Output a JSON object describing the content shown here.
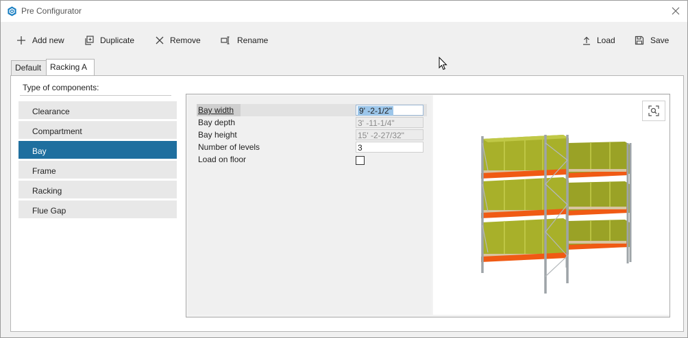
{
  "window": {
    "title": "Pre Configurator"
  },
  "toolbar": {
    "add_new": "Add new",
    "duplicate": "Duplicate",
    "remove": "Remove",
    "rename": "Rename",
    "load": "Load",
    "save": "Save"
  },
  "tabs": [
    {
      "label": "Default",
      "active": false
    },
    {
      "label": "Racking A",
      "active": true
    }
  ],
  "components": {
    "heading": "Type of components:",
    "items": [
      "Clearance",
      "Compartment",
      "Bay",
      "Frame",
      "Racking",
      "Flue Gap"
    ],
    "selected": "Bay"
  },
  "properties": [
    {
      "label": "Bay width",
      "value": "9' -2-1/2\"",
      "editable": true,
      "selected": true
    },
    {
      "label": "Bay depth",
      "value": "3' -11-1/4\"",
      "editable": false
    },
    {
      "label": "Bay height",
      "value": "15' -2-27/32\"",
      "editable": false
    },
    {
      "label": "Number of levels",
      "value": "3",
      "editable": true
    },
    {
      "label": "Load on floor",
      "value": "",
      "type": "checkbox",
      "checked": false
    }
  ],
  "colors": {
    "selected_item": "#1f6f9f",
    "rack_upright": "#9ea4a8",
    "rack_beam": "#f05a14",
    "load": "#a8b02a",
    "pallet": "#d8c4a0"
  },
  "icons": {
    "app": "app-hex-icon",
    "close": "close-icon",
    "add": "plus-icon",
    "duplicate": "duplicate-icon",
    "remove": "x-icon",
    "rename": "rename-icon",
    "load": "upload-icon",
    "save": "save-icon",
    "zoom": "zoom-fit-icon"
  }
}
